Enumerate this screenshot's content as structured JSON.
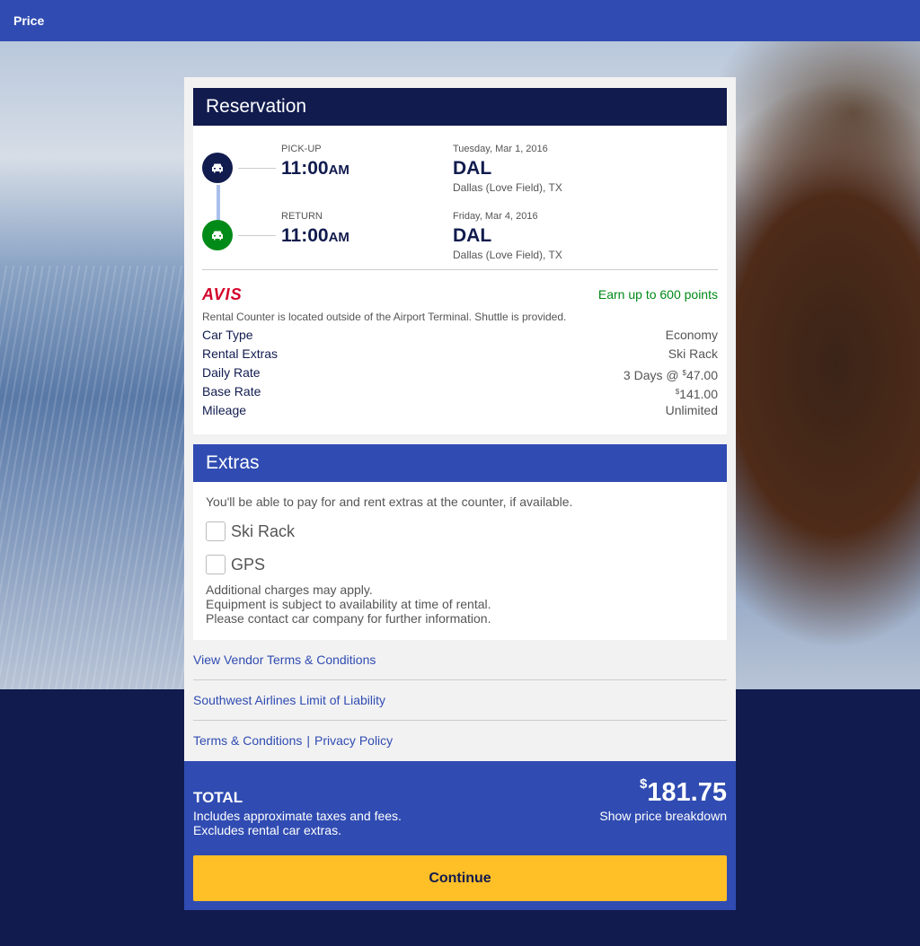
{
  "header": {
    "title": "Price"
  },
  "reservation": {
    "title": "Reservation",
    "pickup": {
      "label": "PICK-UP",
      "time": "11:00",
      "ampm": "AM",
      "date": "Tuesday, Mar 1, 2016",
      "code": "DAL",
      "city": "Dallas (Love Field), TX"
    },
    "return": {
      "label": "RETURN",
      "time": "11:00",
      "ampm": "AM",
      "date": "Friday, Mar 4, 2016",
      "code": "DAL",
      "city": "Dallas (Love Field), TX"
    },
    "vendor": "AVIS",
    "points": "Earn up to 600 points",
    "note": "Rental Counter is located outside of the Airport Terminal. Shuttle is provided.",
    "details": [
      {
        "label": "Car Type",
        "value": "Economy"
      },
      {
        "label": "Rental Extras",
        "value": "Ski Rack"
      },
      {
        "label": "Daily Rate",
        "value_prefix": "3 Days @ ",
        "currency": "$",
        "value": "47.00"
      },
      {
        "label": "Base Rate",
        "currency": "$",
        "value": "141.00"
      },
      {
        "label": "Mileage",
        "value": "Unlimited"
      }
    ]
  },
  "extras": {
    "title": "Extras",
    "intro": "You'll be able to pay for and rent extras at the counter, if available.",
    "options": [
      {
        "label": "Ski Rack",
        "checked": false
      },
      {
        "label": "GPS",
        "checked": false
      }
    ],
    "fine_print": [
      "Additional charges may apply.",
      "Equipment is subject to availability at time of rental.",
      "Please contact car company for further information."
    ]
  },
  "links": {
    "vendor_terms": "View Vendor Terms & Conditions",
    "liability": "Southwest Airlines Limit of Liability",
    "terms": "Terms & Conditions",
    "separator": "|",
    "privacy": "Privacy Policy"
  },
  "total": {
    "label": "TOTAL",
    "sub1": "Includes approximate taxes and fees.",
    "sub2": "Excludes rental car extras.",
    "currency": "$",
    "amount": "181.75",
    "breakdown": "Show price breakdown"
  },
  "continue_label": "Continue",
  "icons": {
    "pickup": "car-icon",
    "return": "car-icon"
  },
  "colors": {
    "brand_blue": "#304cb2",
    "navy": "#111b4e",
    "yellow": "#ffbf27",
    "green": "#008a17",
    "avis_red": "#d4002a"
  }
}
